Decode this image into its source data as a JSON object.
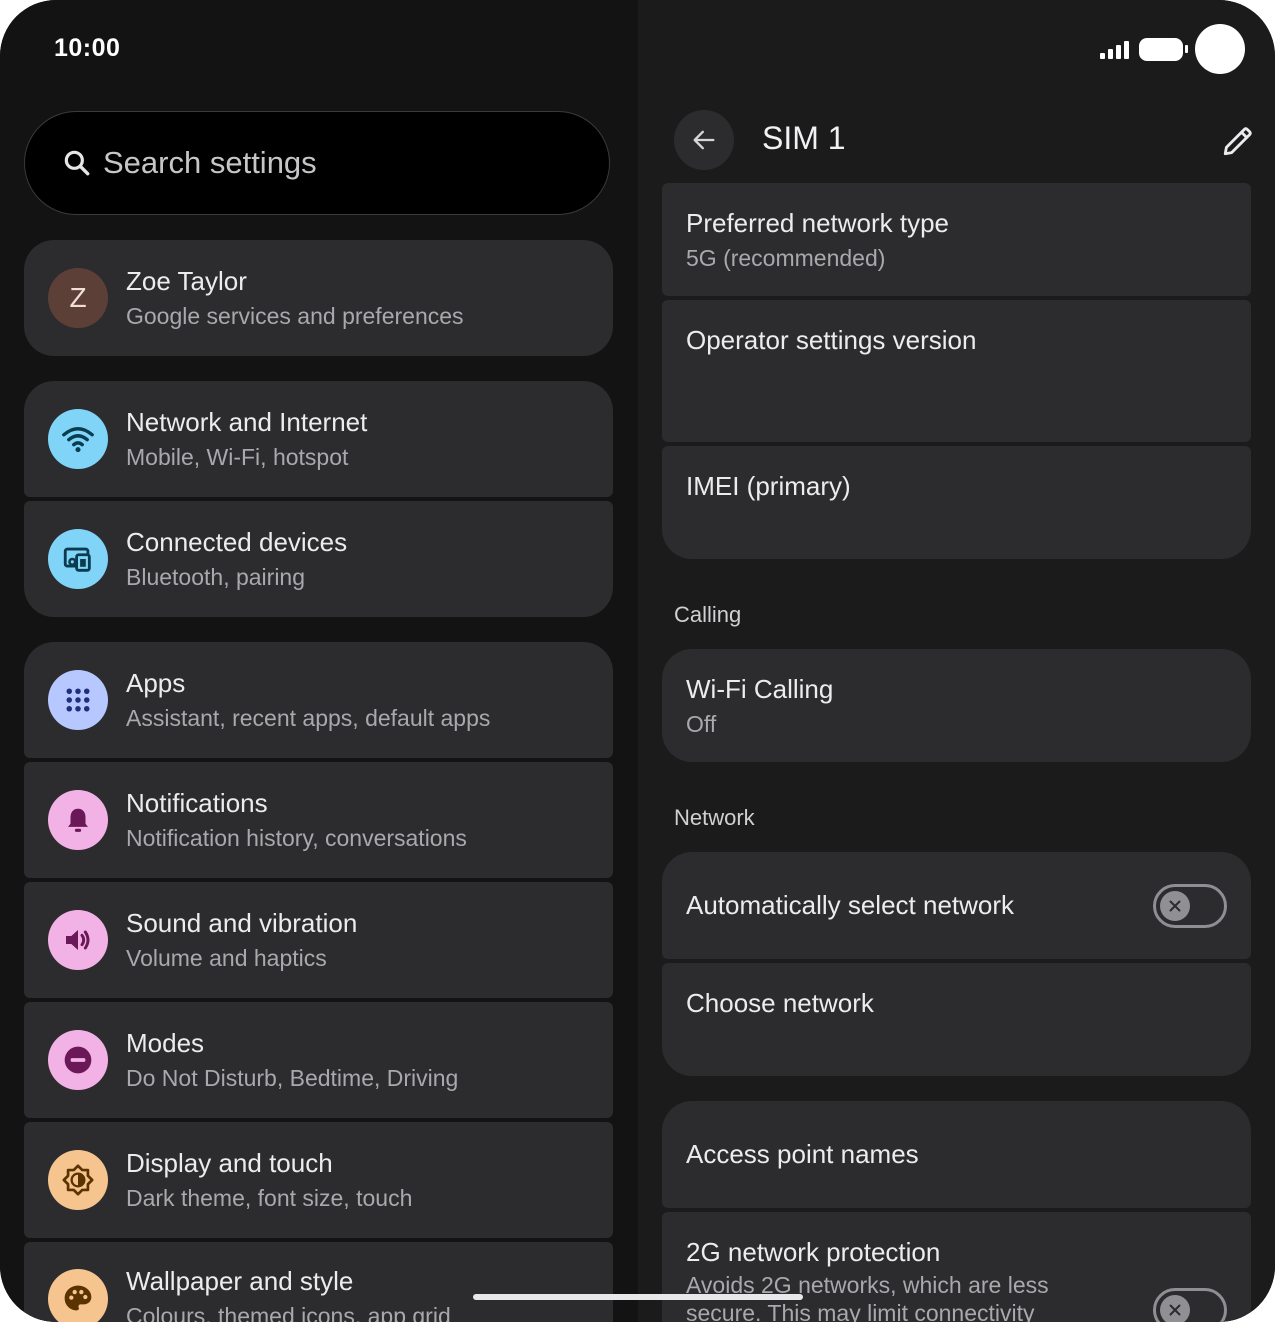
{
  "status_bar": {
    "time": "10:00"
  },
  "search": {
    "placeholder": "Search settings"
  },
  "account": {
    "initial": "Z",
    "name": "Zoe Taylor",
    "subtitle": "Google services and preferences",
    "avatar_color": "#5c4038"
  },
  "settings_items": [
    {
      "title": "Network and Internet",
      "subtitle": "Mobile, Wi-Fi, hotspot",
      "icon": "wifi-icon",
      "icon_color": "#80d4f8"
    },
    {
      "title": "Connected devices",
      "subtitle": "Bluetooth, pairing",
      "icon": "connected-devices-icon",
      "icon_color": "#80d4f8"
    },
    {
      "title": "Apps",
      "subtitle": "Assistant, recent apps, default apps",
      "icon": "apps-grid-icon",
      "icon_color": "#b7c7ff"
    },
    {
      "title": "Notifications",
      "subtitle": "Notification history, conversations",
      "icon": "bell-icon",
      "icon_color": "#f3b2e6"
    },
    {
      "title": "Sound and vibration",
      "subtitle": "Volume and haptics",
      "icon": "speaker-icon",
      "icon_color": "#f3b2e6"
    },
    {
      "title": "Modes",
      "subtitle": "Do Not Disturb, Bedtime, Driving",
      "icon": "do-not-disturb-icon",
      "icon_color": "#f3b2e6"
    },
    {
      "title": "Display and touch",
      "subtitle": "Dark theme, font size, touch",
      "icon": "brightness-icon",
      "icon_color": "#f6c48f"
    },
    {
      "title": "Wallpaper and style",
      "subtitle": "Colours, themed icons, app grid",
      "icon": "palette-icon",
      "icon_color": "#f6c48f"
    }
  ],
  "detail": {
    "title": "SIM 1",
    "rows": {
      "preferred_network": {
        "title": "Preferred network type",
        "subtitle": "5G (recommended)"
      },
      "operator_version": {
        "title": "Operator settings version"
      },
      "imei": {
        "title": "IMEI (primary)"
      },
      "wifi_calling": {
        "title": "Wi-Fi Calling",
        "subtitle": "Off"
      },
      "auto_select": {
        "title": "Automatically select network",
        "state": "off"
      },
      "choose_network": {
        "title": "Choose network"
      },
      "apn": {
        "title": "Access point names"
      },
      "protection_2g": {
        "title": "2G network protection",
        "subtitle_line1": "Avoids 2G networks, which are less",
        "subtitle_line2": "secure. This may limit connectivity",
        "state": "off"
      }
    },
    "sections": {
      "calling": "Calling",
      "network": "Network"
    }
  },
  "colors": {
    "background": "#131313",
    "card": "#2c2c2e",
    "text_primary": "#ececee",
    "text_secondary": "#a9a9ad"
  }
}
